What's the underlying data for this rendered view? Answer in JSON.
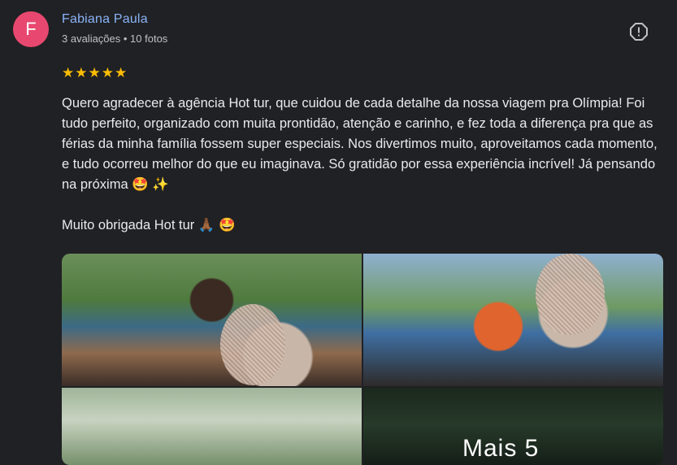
{
  "reviewer": {
    "initial": "F",
    "name": "Fabiana Paula",
    "meta": "3 avaliações • 10 fotos",
    "avatar_color": "#e8486f"
  },
  "report_icon": "report-icon",
  "rating": {
    "stars": "★★★★★",
    "value": 5,
    "max": 5
  },
  "review": {
    "paragraph1": "Quero agradecer à agência Hot tur, que cuidou de cada detalhe da nossa viagem pra Olímpia! Foi tudo perfeito, organizado com muita prontidão, atenção e carinho, e fez toda a diferença pra que as férias da minha família fossem super especiais. Nos divertimos muito, aproveitamos cada momento, e tudo ocorreu melhor do que eu imaginava. Só gratidão por essa experiência incrível! Já pensando na próxima 🤩 ✨",
    "paragraph2": "Muito obrigada Hot tur 🙏🏾 🤩"
  },
  "photos": {
    "more_label": "Mais 5"
  },
  "colors": {
    "background": "#202124",
    "name_link": "#8ab4f8",
    "star": "#fbbc04"
  }
}
